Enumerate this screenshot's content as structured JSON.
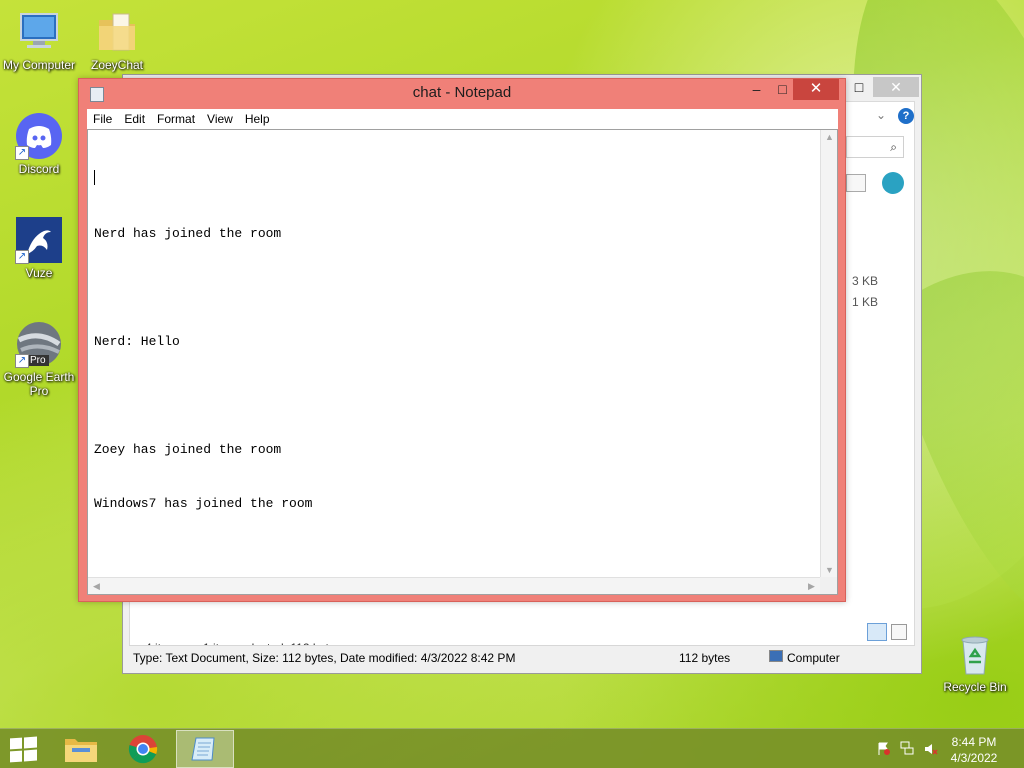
{
  "desktop": {
    "icons": [
      {
        "label": "My Computer"
      },
      {
        "label": "ZoeyChat"
      },
      {
        "label": "Discord"
      },
      {
        "label": "Vuze"
      },
      {
        "label": "Google Earth Pro"
      },
      {
        "label": "Recycle Bin"
      }
    ],
    "google_earth_badge": "Pro"
  },
  "notepad": {
    "title": "chat - Notepad",
    "menu": [
      "File",
      "Edit",
      "Format",
      "View",
      "Help"
    ],
    "controls": {
      "minimize": "–",
      "maximize": "□",
      "close": "✕"
    },
    "lines": [
      "",
      "Nerd has joined the room",
      "",
      "Nerd: Hello",
      "",
      "Zoey has joined the room",
      "Windows7 has joined the room"
    ]
  },
  "explorer": {
    "file_sizes": [
      "3 KB",
      "1 KB"
    ],
    "items_count": "4 items",
    "selection": "1 item selected  112 bytes",
    "details": "Type: Text Document, Size: 112 bytes, Date modified: 4/3/2022 8:42 PM",
    "size": "112 bytes",
    "location": "Computer",
    "controls": {
      "maximize": "□",
      "close": "✕"
    }
  },
  "taskbar": {
    "items": [
      "file-explorer",
      "chrome",
      "notepad"
    ],
    "time": "8:44 PM",
    "date": "4/3/2022"
  },
  "colors": {
    "notepad_frame": "#f08078",
    "close_button": "#c9453e",
    "wallpaper": "#a9d420"
  }
}
